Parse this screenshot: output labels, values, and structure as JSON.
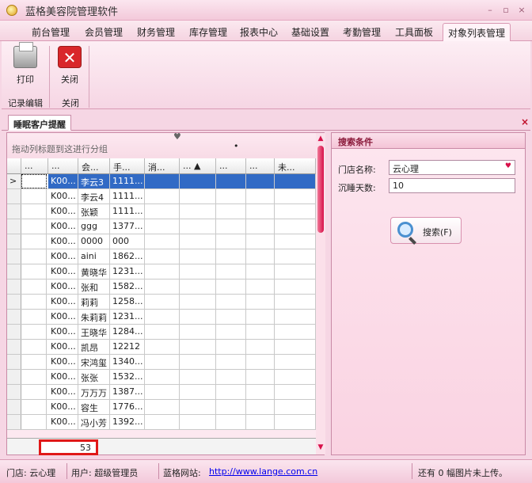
{
  "window": {
    "title": "蓝格美容院管理软件"
  },
  "menu": [
    "前台管理",
    "会员管理",
    "财务管理",
    "库存管理",
    "报表中心",
    "基础设置",
    "考勤管理",
    "工具面板",
    "对象列表管理"
  ],
  "ribbon": {
    "print_label": "打印",
    "close_label": "关闭",
    "group1_label": "记录编辑",
    "group2_label": "关闭"
  },
  "doc_tab": {
    "label": "睡眠客户提醒",
    "close": "×"
  },
  "grid": {
    "groupby_hint": "拖动列标题到这进行分组",
    "headers": [
      "...",
      "...",
      "会...",
      "手...",
      "消...",
      "... ▲",
      "...",
      "...",
      "未..."
    ],
    "rows": [
      {
        "id": "K00...",
        "name": "李云3",
        "phone": "1111..."
      },
      {
        "id": "K00...",
        "name": "李云4",
        "phone": "1111..."
      },
      {
        "id": "K00...",
        "name": "张颖",
        "phone": "1111..."
      },
      {
        "id": "K00...",
        "name": "ggg",
        "phone": "1377..."
      },
      {
        "id": "K00...",
        "name": "0000",
        "phone": "000"
      },
      {
        "id": "K00...",
        "name": "aini",
        "phone": "1862..."
      },
      {
        "id": "K00...",
        "name": "黄晓华",
        "phone": "1231..."
      },
      {
        "id": "K00...",
        "name": "张和",
        "phone": "1582..."
      },
      {
        "id": "K00...",
        "name": "莉莉",
        "phone": "1258..."
      },
      {
        "id": "K00...",
        "name": "朱莉莉",
        "phone": "1231..."
      },
      {
        "id": "K00...",
        "name": "王晓华",
        "phone": "1284..."
      },
      {
        "id": "K00...",
        "name": "凯昂",
        "phone": "12212"
      },
      {
        "id": "K00...",
        "name": "宋鸿玺",
        "phone": "1340..."
      },
      {
        "id": "K00...",
        "name": "张张",
        "phone": "1532..."
      },
      {
        "id": "K00...",
        "name": "万万万",
        "phone": "1387..."
      },
      {
        "id": "K00...",
        "name": "容生",
        "phone": "1776..."
      },
      {
        "id": "K00...",
        "name": "冯小芳",
        "phone": "1392..."
      }
    ],
    "selected_index": 0,
    "row_marker": ">",
    "footer_count": "53"
  },
  "search": {
    "title": "搜索条件",
    "store_label": "门店名称:",
    "store_value": "云心理",
    "sleep_days_label": "沉睡天数:",
    "sleep_days_value": "10",
    "button_label": "搜索(F)"
  },
  "status": {
    "store": "门店: 云心理",
    "user": "用户: 超级管理员",
    "site_label": "蓝格网站:",
    "site_url": "http://www.lange.com.cn",
    "upload_note": "还有 0 幅图片未上传。"
  }
}
